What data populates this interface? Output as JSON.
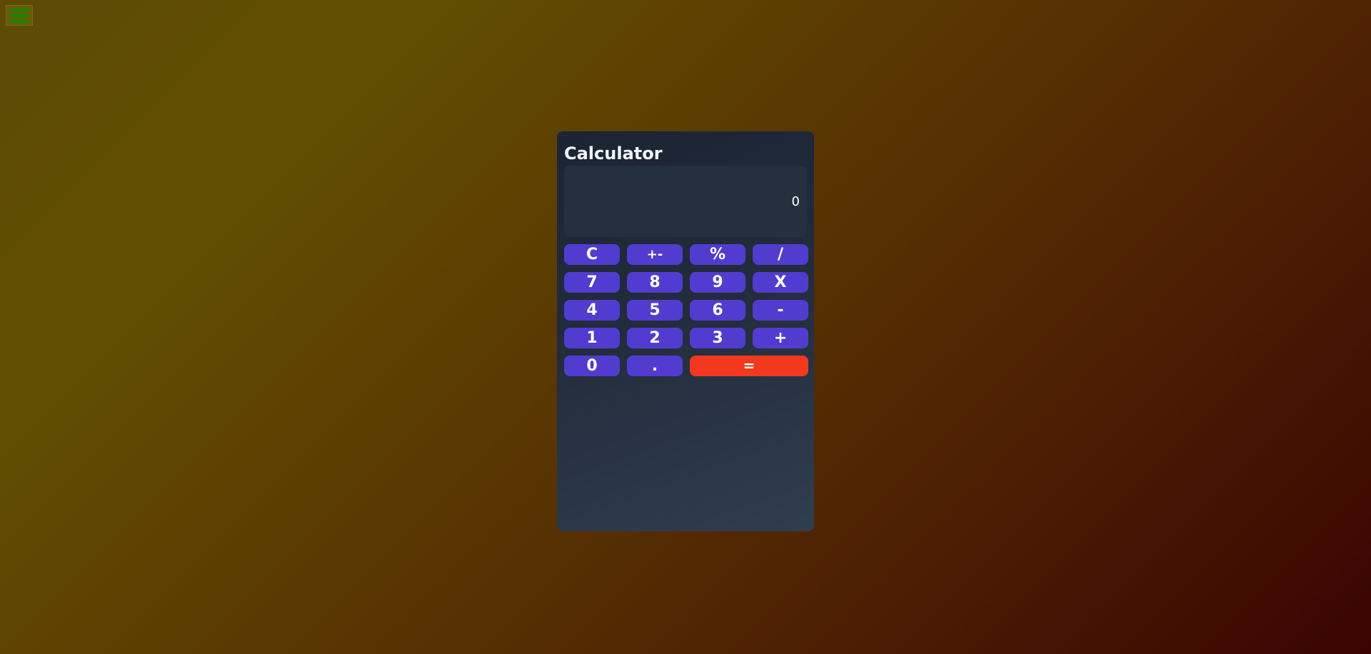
{
  "menu": {
    "icon": "hamburger-menu-icon",
    "color": "#0f8a0a"
  },
  "calculator": {
    "title": "Calculator",
    "display_value": "0",
    "keys": [
      {
        "label": "C",
        "name": "clear-button"
      },
      {
        "label": "+-",
        "name": "toggle-sign-button"
      },
      {
        "label": "%",
        "name": "percent-button"
      },
      {
        "label": "/",
        "name": "divide-button"
      },
      {
        "label": "7",
        "name": "digit-7-button"
      },
      {
        "label": "8",
        "name": "digit-8-button"
      },
      {
        "label": "9",
        "name": "digit-9-button"
      },
      {
        "label": "X",
        "name": "multiply-button"
      },
      {
        "label": "4",
        "name": "digit-4-button"
      },
      {
        "label": "5",
        "name": "digit-5-button"
      },
      {
        "label": "6",
        "name": "digit-6-button"
      },
      {
        "label": "-",
        "name": "subtract-button"
      },
      {
        "label": "1",
        "name": "digit-1-button"
      },
      {
        "label": "2",
        "name": "digit-2-button"
      },
      {
        "label": "3",
        "name": "digit-3-button"
      },
      {
        "label": "+",
        "name": "add-button"
      },
      {
        "label": "0",
        "name": "digit-0-button"
      },
      {
        "label": ".",
        "name": "decimal-button"
      },
      {
        "label": "=",
        "name": "equals-button"
      }
    ],
    "colors": {
      "key": "#513ccf",
      "equals": "#f2391e"
    }
  }
}
